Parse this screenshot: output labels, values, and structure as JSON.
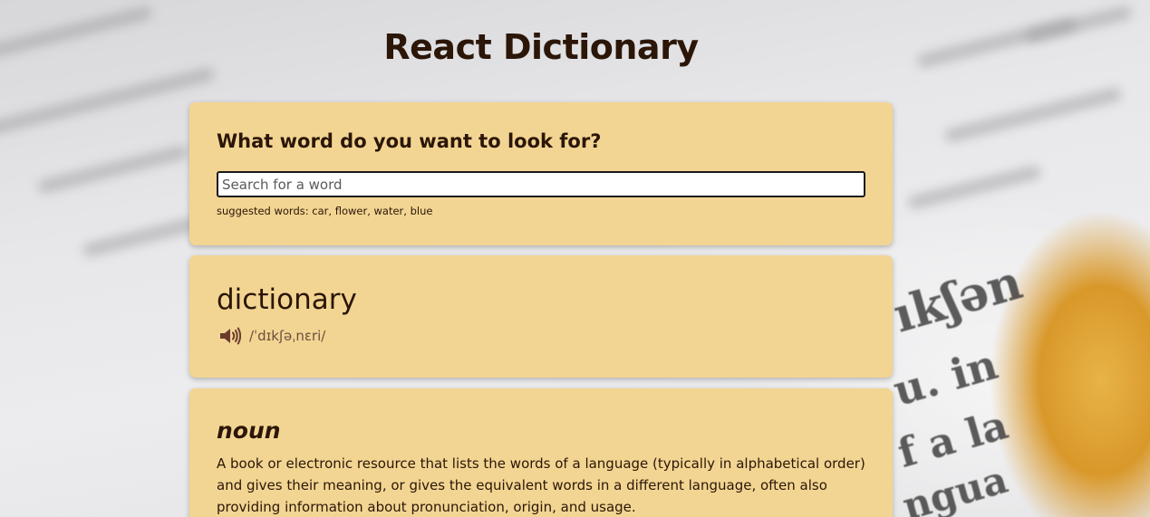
{
  "app": {
    "title": "React Dictionary"
  },
  "search": {
    "question": "What word do you want to look for?",
    "placeholder": "Search for a word",
    "value": "",
    "suggestions_prefix": "suggested words:",
    "suggestions": [
      "car",
      "flower",
      "water",
      "blue"
    ]
  },
  "result": {
    "word": "dictionary",
    "audio_icon": "speaker-icon",
    "phonetic": "/ˈdɪkʃəˌnɛri/"
  },
  "meaning": {
    "part_of_speech": "noun",
    "definition": "A book or electronic resource that lists the words of a language (typically in alphabetical order) and gives their meaning, or gives the equivalent words in a different language, often also providing information about pronunciation, origin, and usage."
  },
  "colors": {
    "card_background": "#f2d592",
    "title_text": "#2b1608",
    "speaker_icon": "#6b3a2e",
    "phonetic_text": "#6b4d40"
  }
}
